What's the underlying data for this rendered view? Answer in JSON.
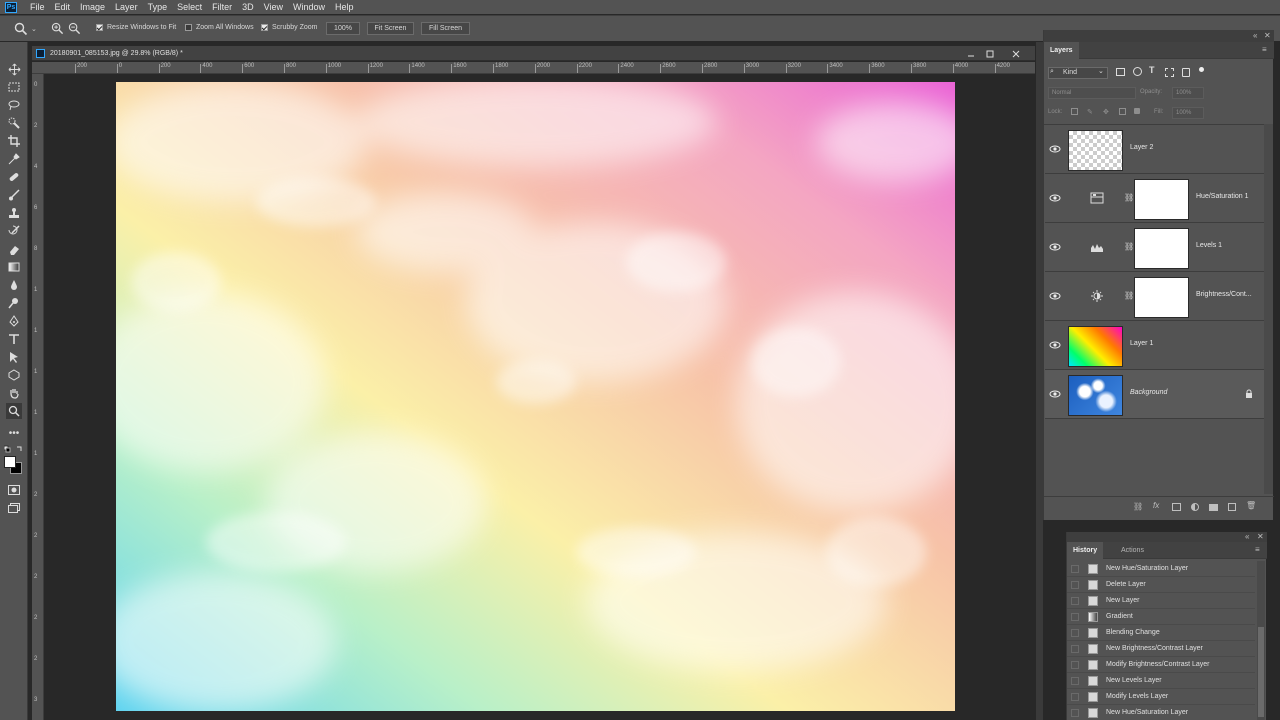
{
  "app": {
    "logo_text": "Ps"
  },
  "menu": [
    "File",
    "Edit",
    "Image",
    "Layer",
    "Type",
    "Select",
    "Filter",
    "3D",
    "View",
    "Window",
    "Help"
  ],
  "options_bar": {
    "resize_windows": "Resize Windows to Fit",
    "zoom_all": "Zoom All Windows",
    "scrubby_zoom": "Scrubby Zoom",
    "zoom_value": "100%",
    "fit_screen": "Fit Screen",
    "fill_screen": "Fill Screen"
  },
  "document": {
    "title": "20180901_085153.jpg @ 29.8% (RGB/8) *",
    "ruler_h_ticks": [
      "200",
      "0",
      "200",
      "400",
      "600",
      "800",
      "1000",
      "1200",
      "1400",
      "1600",
      "1800",
      "2000",
      "2200",
      "2400",
      "2600",
      "2800",
      "3000",
      "3200",
      "3400",
      "3600",
      "3800",
      "4000",
      "4200"
    ],
    "ruler_v_ticks": [
      "0",
      "2",
      "4",
      "6",
      "8",
      "1",
      "1",
      "1",
      "1",
      "1",
      "2",
      "2",
      "2",
      "2",
      "2",
      "3",
      "3"
    ]
  },
  "layers_panel": {
    "tab": "Layers",
    "kind_filter": "Kind",
    "blend_mode": "Normal",
    "opacity_label": "Opacity:",
    "opacity_value": "100%",
    "lock_label": "Lock:",
    "fill_label": "Fill:",
    "fill_value": "100%",
    "layers": [
      {
        "name": "Layer 2"
      },
      {
        "name": "Hue/Saturation 1"
      },
      {
        "name": "Levels 1"
      },
      {
        "name": "Brightness/Cont..."
      },
      {
        "name": "Layer 1"
      },
      {
        "name": "Background"
      }
    ],
    "footer_fx": "fx"
  },
  "history_panel": {
    "tabs": [
      "History",
      "Actions"
    ],
    "items": [
      "New Hue/Saturation Layer",
      "Delete Layer",
      "New Layer",
      "Gradient",
      "Blending Change",
      "New Brightness/Contrast Layer",
      "Modify Brightness/Contrast Layer",
      "New Levels Layer",
      "Modify Levels Layer",
      "New Hue/Saturation Layer"
    ]
  },
  "colors": {
    "ui_bg": "#535353",
    "canvas_bg": "#282828",
    "accent": "#31a8ff"
  }
}
